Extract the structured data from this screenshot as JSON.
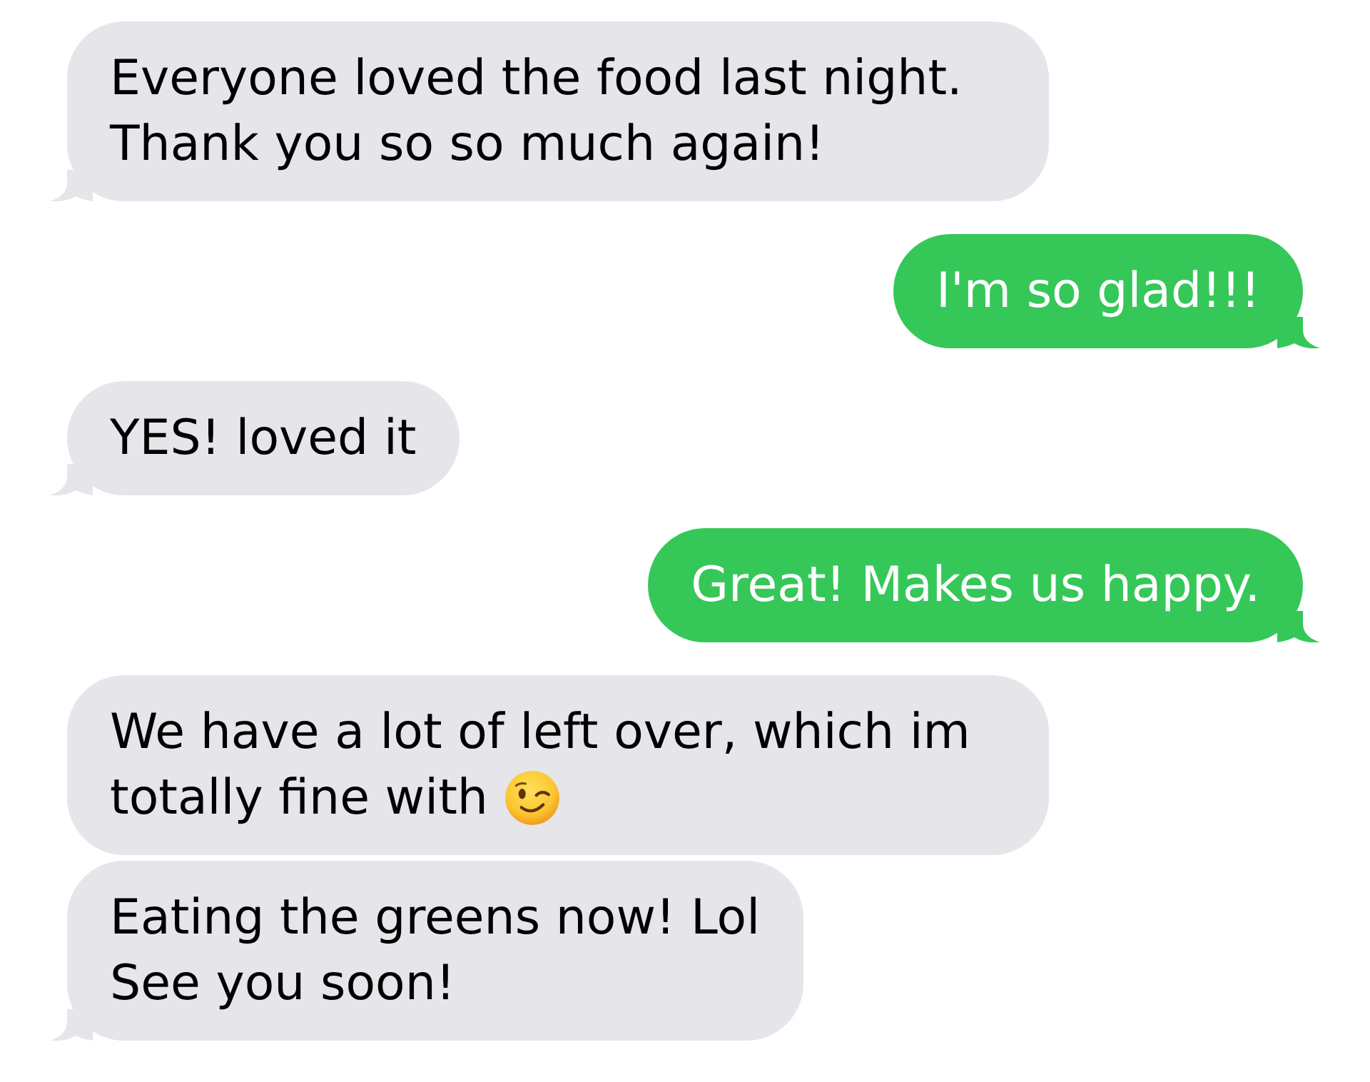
{
  "messages": [
    {
      "kind": "received",
      "text": "Everyone loved the food last night. Thank you so so much again!",
      "tail": true
    },
    {
      "kind": "sent",
      "text": "I'm so glad!!!",
      "tail": true
    },
    {
      "kind": "received",
      "text": "YES! loved it",
      "tail": true
    },
    {
      "kind": "sent",
      "text": "Great! Makes us happy.",
      "tail": true
    },
    {
      "kind": "received",
      "text": "We have a lot of left over, which im totally fine with",
      "trailing_emoji": true,
      "tail": false
    },
    {
      "kind": "received",
      "text": "Eating the greens now! Lol\nSee you soon!",
      "tail": true
    }
  ]
}
